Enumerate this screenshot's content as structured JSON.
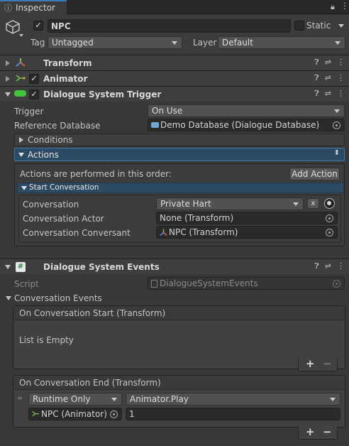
{
  "tab": {
    "title": "Inspector"
  },
  "object": {
    "name": "NPC",
    "static_label": "Static",
    "tag_label": "Tag",
    "tag_value": "Untagged",
    "layer_label": "Layer",
    "layer_value": "Default"
  },
  "components": {
    "transform": "Transform",
    "animator": "Animator",
    "trigger": "Dialogue System Trigger",
    "events": "Dialogue System Events"
  },
  "trigger": {
    "trigger_label": "Trigger",
    "trigger_value": "On Use",
    "refdb_label": "Reference Database",
    "refdb_value": "Demo Database (Dialogue Database)",
    "conditions": "Conditions",
    "actions": "Actions",
    "order_text": "Actions are performed in this order:",
    "add_action": "Add Action",
    "start_conv": "Start Conversation",
    "conv_label": "Conversation",
    "conv_value": "Private Hart",
    "conv_x": "x",
    "actor_label": "Conversation Actor",
    "actor_value": "None (Transform)",
    "conversant_label": "Conversation Conversant",
    "conversant_value": "NPC (Transform)"
  },
  "events": {
    "script_label": "Script",
    "script_value": "DialogueSystemEvents",
    "conv_events": "Conversation Events",
    "start_header": "On Conversation Start (Transform)",
    "list_empty": "List is Empty",
    "end_header": "On Conversation End (Transform)",
    "runtime": "Runtime Only",
    "function": "Animator.Play",
    "target_obj": "NPC (Animator)",
    "arg": "1",
    "plus": "+",
    "minus": "−"
  }
}
